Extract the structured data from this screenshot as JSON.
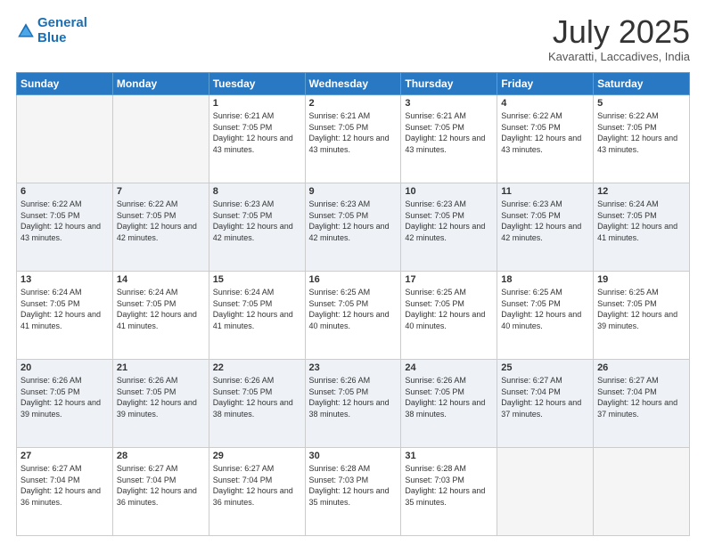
{
  "header": {
    "logo_line1": "General",
    "logo_line2": "Blue",
    "month": "July 2025",
    "location": "Kavaratti, Laccadives, India"
  },
  "weekdays": [
    "Sunday",
    "Monday",
    "Tuesday",
    "Wednesday",
    "Thursday",
    "Friday",
    "Saturday"
  ],
  "weeks": [
    [
      {
        "day": "",
        "info": ""
      },
      {
        "day": "",
        "info": ""
      },
      {
        "day": "1",
        "info": "Sunrise: 6:21 AM\nSunset: 7:05 PM\nDaylight: 12 hours and 43 minutes."
      },
      {
        "day": "2",
        "info": "Sunrise: 6:21 AM\nSunset: 7:05 PM\nDaylight: 12 hours and 43 minutes."
      },
      {
        "day": "3",
        "info": "Sunrise: 6:21 AM\nSunset: 7:05 PM\nDaylight: 12 hours and 43 minutes."
      },
      {
        "day": "4",
        "info": "Sunrise: 6:22 AM\nSunset: 7:05 PM\nDaylight: 12 hours and 43 minutes."
      },
      {
        "day": "5",
        "info": "Sunrise: 6:22 AM\nSunset: 7:05 PM\nDaylight: 12 hours and 43 minutes."
      }
    ],
    [
      {
        "day": "6",
        "info": "Sunrise: 6:22 AM\nSunset: 7:05 PM\nDaylight: 12 hours and 43 minutes."
      },
      {
        "day": "7",
        "info": "Sunrise: 6:22 AM\nSunset: 7:05 PM\nDaylight: 12 hours and 42 minutes."
      },
      {
        "day": "8",
        "info": "Sunrise: 6:23 AM\nSunset: 7:05 PM\nDaylight: 12 hours and 42 minutes."
      },
      {
        "day": "9",
        "info": "Sunrise: 6:23 AM\nSunset: 7:05 PM\nDaylight: 12 hours and 42 minutes."
      },
      {
        "day": "10",
        "info": "Sunrise: 6:23 AM\nSunset: 7:05 PM\nDaylight: 12 hours and 42 minutes."
      },
      {
        "day": "11",
        "info": "Sunrise: 6:23 AM\nSunset: 7:05 PM\nDaylight: 12 hours and 42 minutes."
      },
      {
        "day": "12",
        "info": "Sunrise: 6:24 AM\nSunset: 7:05 PM\nDaylight: 12 hours and 41 minutes."
      }
    ],
    [
      {
        "day": "13",
        "info": "Sunrise: 6:24 AM\nSunset: 7:05 PM\nDaylight: 12 hours and 41 minutes."
      },
      {
        "day": "14",
        "info": "Sunrise: 6:24 AM\nSunset: 7:05 PM\nDaylight: 12 hours and 41 minutes."
      },
      {
        "day": "15",
        "info": "Sunrise: 6:24 AM\nSunset: 7:05 PM\nDaylight: 12 hours and 41 minutes."
      },
      {
        "day": "16",
        "info": "Sunrise: 6:25 AM\nSunset: 7:05 PM\nDaylight: 12 hours and 40 minutes."
      },
      {
        "day": "17",
        "info": "Sunrise: 6:25 AM\nSunset: 7:05 PM\nDaylight: 12 hours and 40 minutes."
      },
      {
        "day": "18",
        "info": "Sunrise: 6:25 AM\nSunset: 7:05 PM\nDaylight: 12 hours and 40 minutes."
      },
      {
        "day": "19",
        "info": "Sunrise: 6:25 AM\nSunset: 7:05 PM\nDaylight: 12 hours and 39 minutes."
      }
    ],
    [
      {
        "day": "20",
        "info": "Sunrise: 6:26 AM\nSunset: 7:05 PM\nDaylight: 12 hours and 39 minutes."
      },
      {
        "day": "21",
        "info": "Sunrise: 6:26 AM\nSunset: 7:05 PM\nDaylight: 12 hours and 39 minutes."
      },
      {
        "day": "22",
        "info": "Sunrise: 6:26 AM\nSunset: 7:05 PM\nDaylight: 12 hours and 38 minutes."
      },
      {
        "day": "23",
        "info": "Sunrise: 6:26 AM\nSunset: 7:05 PM\nDaylight: 12 hours and 38 minutes."
      },
      {
        "day": "24",
        "info": "Sunrise: 6:26 AM\nSunset: 7:05 PM\nDaylight: 12 hours and 38 minutes."
      },
      {
        "day": "25",
        "info": "Sunrise: 6:27 AM\nSunset: 7:04 PM\nDaylight: 12 hours and 37 minutes."
      },
      {
        "day": "26",
        "info": "Sunrise: 6:27 AM\nSunset: 7:04 PM\nDaylight: 12 hours and 37 minutes."
      }
    ],
    [
      {
        "day": "27",
        "info": "Sunrise: 6:27 AM\nSunset: 7:04 PM\nDaylight: 12 hours and 36 minutes."
      },
      {
        "day": "28",
        "info": "Sunrise: 6:27 AM\nSunset: 7:04 PM\nDaylight: 12 hours and 36 minutes."
      },
      {
        "day": "29",
        "info": "Sunrise: 6:27 AM\nSunset: 7:04 PM\nDaylight: 12 hours and 36 minutes."
      },
      {
        "day": "30",
        "info": "Sunrise: 6:28 AM\nSunset: 7:03 PM\nDaylight: 12 hours and 35 minutes."
      },
      {
        "day": "31",
        "info": "Sunrise: 6:28 AM\nSunset: 7:03 PM\nDaylight: 12 hours and 35 minutes."
      },
      {
        "day": "",
        "info": ""
      },
      {
        "day": "",
        "info": ""
      }
    ]
  ]
}
